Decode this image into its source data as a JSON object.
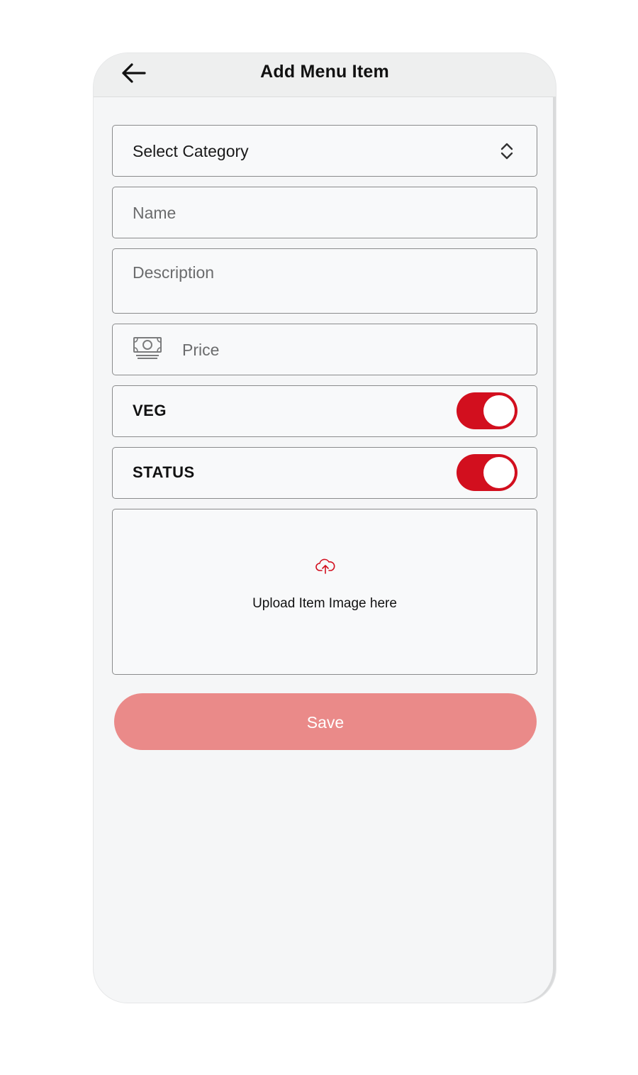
{
  "header": {
    "title": "Add Menu Item",
    "back_icon": "arrow-left-icon"
  },
  "form": {
    "category": {
      "value": "Select Category",
      "icon": "chevron-up-down-icon"
    },
    "name": {
      "placeholder": "Name"
    },
    "description": {
      "placeholder": "Description"
    },
    "price": {
      "placeholder": "Price",
      "icon": "banknote-icon"
    },
    "veg": {
      "label": "VEG",
      "on": true
    },
    "status": {
      "label": "STATUS",
      "on": true
    },
    "upload": {
      "label": "Upload Item Image here",
      "icon": "cloud-upload-icon"
    },
    "save_label": "Save"
  },
  "colors": {
    "accent": "#d20f1e",
    "save_button": "#ea8a89",
    "upload_icon": "#d20f1e",
    "background": "#f5f6f7"
  }
}
